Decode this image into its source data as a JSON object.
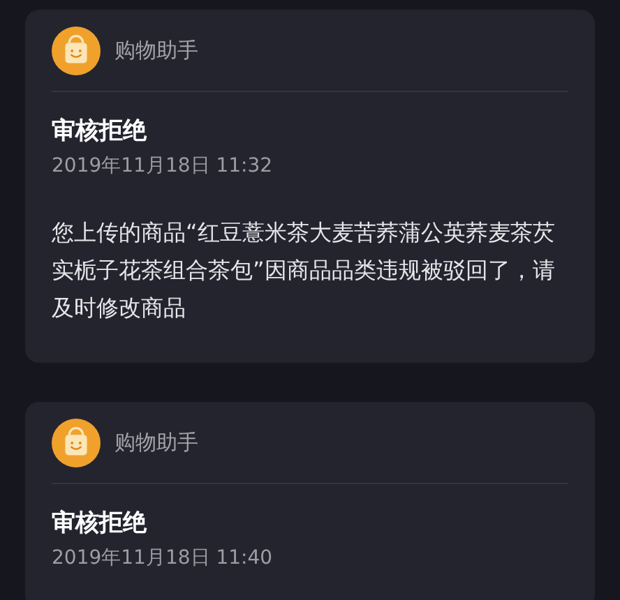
{
  "messages": [
    {
      "sender": "购物助手",
      "title": "审核拒绝",
      "time": "2019年11月18日 11:32",
      "body": "您上传的商品“红豆薏米茶大麦苦荞蒲公英荞麦茶芡实栀子花茶组合茶包”因商品品类违规被驳回了，请及时修改商品"
    },
    {
      "sender": "购物助手",
      "title": "审核拒绝",
      "time": "2019年11月18日 11:40"
    }
  ]
}
